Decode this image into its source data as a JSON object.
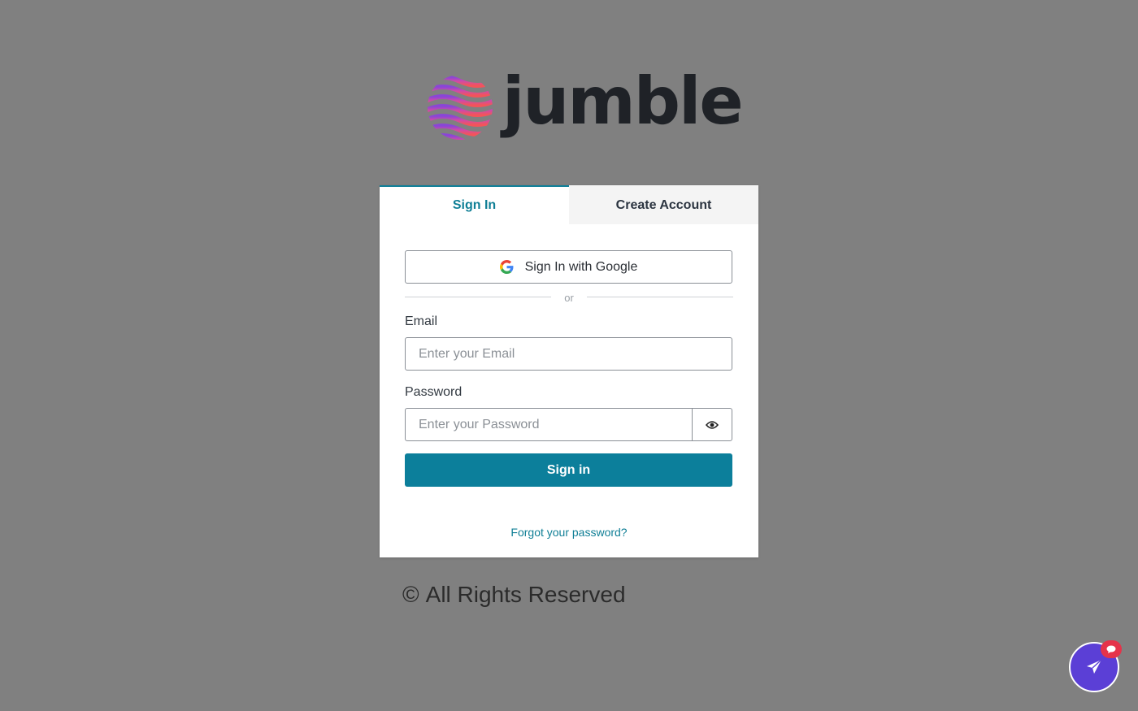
{
  "brand": {
    "name": "jumble"
  },
  "tabs": [
    {
      "label": "Sign In",
      "active": true
    },
    {
      "label": "Create Account",
      "active": false
    }
  ],
  "form": {
    "google_label": "Sign In with Google",
    "divider_text": "or",
    "email_label": "Email",
    "email_placeholder": "Enter your Email",
    "email_value": "",
    "password_label": "Password",
    "password_placeholder": "Enter your Password",
    "password_value": "",
    "submit_label": "Sign in",
    "forgot_label": "Forgot your password?"
  },
  "footer": {
    "copyright_symbol": "©",
    "text": "All Rights Reserved"
  },
  "icons": {
    "google": "google-icon",
    "eye": "eye-icon",
    "chat": "paper-plane-icon",
    "badge": "chat-bubble-icon"
  },
  "colors": {
    "accent": "#0c7f9b",
    "background": "#808080",
    "fab": "#5b3fd6",
    "badge": "#e5334a"
  }
}
